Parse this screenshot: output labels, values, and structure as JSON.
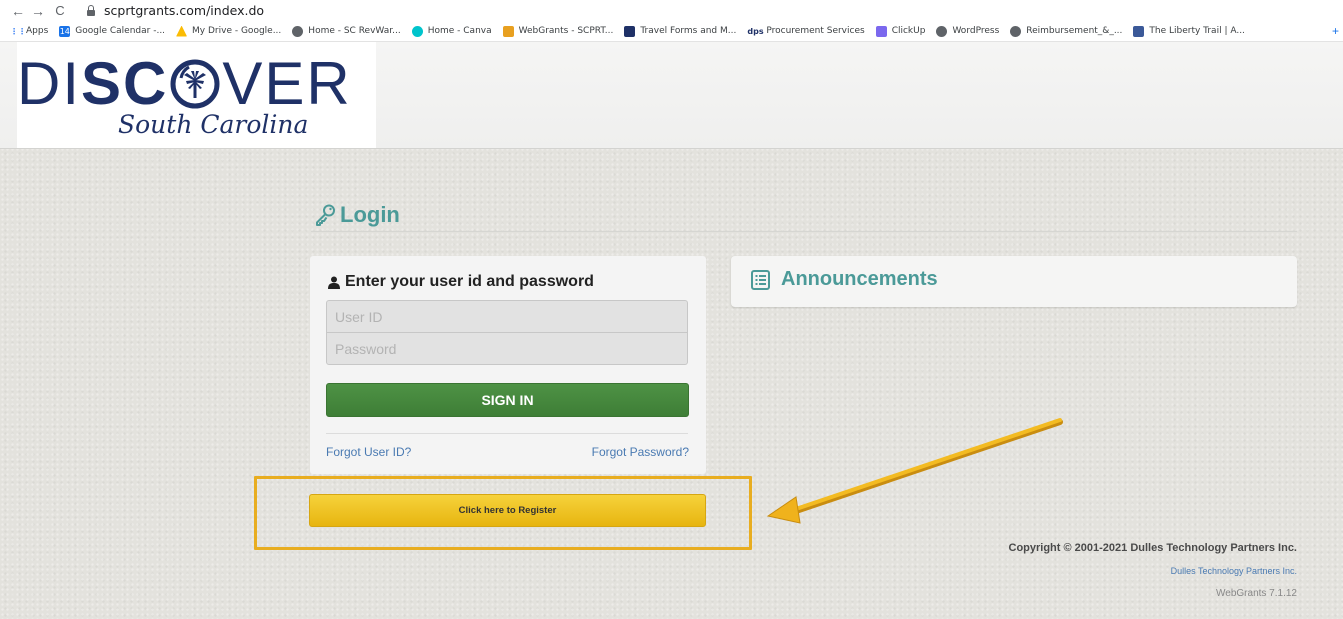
{
  "browser": {
    "url": "scprtgrants.com/index.do",
    "nav": {
      "back": "←",
      "forward": "→",
      "reload": "C"
    },
    "bookmarks": [
      {
        "label": "Apps",
        "icon": "apps-grid-icon",
        "color": "#ea4335"
      },
      {
        "label": "Google Calendar -...",
        "icon": "calendar-icon",
        "color": "#1a73e8"
      },
      {
        "label": "My Drive - Google...",
        "icon": "drive-icon",
        "color": "#fbbc04"
      },
      {
        "label": "Home - SC RevWar...",
        "icon": "globe-icon",
        "color": "#5f6368"
      },
      {
        "label": "Home - Canva",
        "icon": "canva-icon",
        "color": "#00c4cc"
      },
      {
        "label": "WebGrants - SCPRT...",
        "icon": "webgrants-icon",
        "color": "#e8a020"
      },
      {
        "label": "Travel Forms and M...",
        "icon": "travel-icon",
        "color": "#1f3167"
      },
      {
        "label": "Procurement Services",
        "icon": "dps-icon",
        "color": "#1f3167"
      },
      {
        "label": "ClickUp",
        "icon": "clickup-icon",
        "color": "#7b68ee"
      },
      {
        "label": "WordPress",
        "icon": "globe-icon",
        "color": "#5f6368"
      },
      {
        "label": "Reimbursement_&_...",
        "icon": "globe-icon",
        "color": "#5f6368"
      },
      {
        "label": "The Liberty Trail | A...",
        "icon": "liberty-icon",
        "color": "#3b5998"
      }
    ],
    "bookmark_glyphs": {
      "apps": "⋮⋮",
      "calendar": "14",
      "dps": "dps"
    }
  },
  "header": {
    "logo_part1": "DI",
    "logo_part2": "SC",
    "logo_part3": "VER",
    "logo_sub": "South Carolina",
    "brand_color": "#1f3167"
  },
  "login": {
    "title": "Login",
    "panel_heading": "Enter your user id and password",
    "user_id_placeholder": "User ID",
    "password_placeholder": "Password",
    "sign_in_label": "SIGN IN",
    "forgot_user_id": "Forgot User ID?",
    "forgot_password": "Forgot Password?",
    "register_label": "Click here to Register",
    "accent_color": "#4b9a98",
    "signin_color": "#4a8c41",
    "register_color": "#efc22a"
  },
  "announcements": {
    "title": "Announcements"
  },
  "footer": {
    "copyright": "Copyright © 2001-2021 Dulles Technology Partners Inc.",
    "company_link": "Dulles Technology Partners Inc.",
    "version": "WebGrants 7.1.12"
  },
  "annotation": {
    "highlight_color": "#e8ad20",
    "arrow_color": "#f0b21c"
  }
}
